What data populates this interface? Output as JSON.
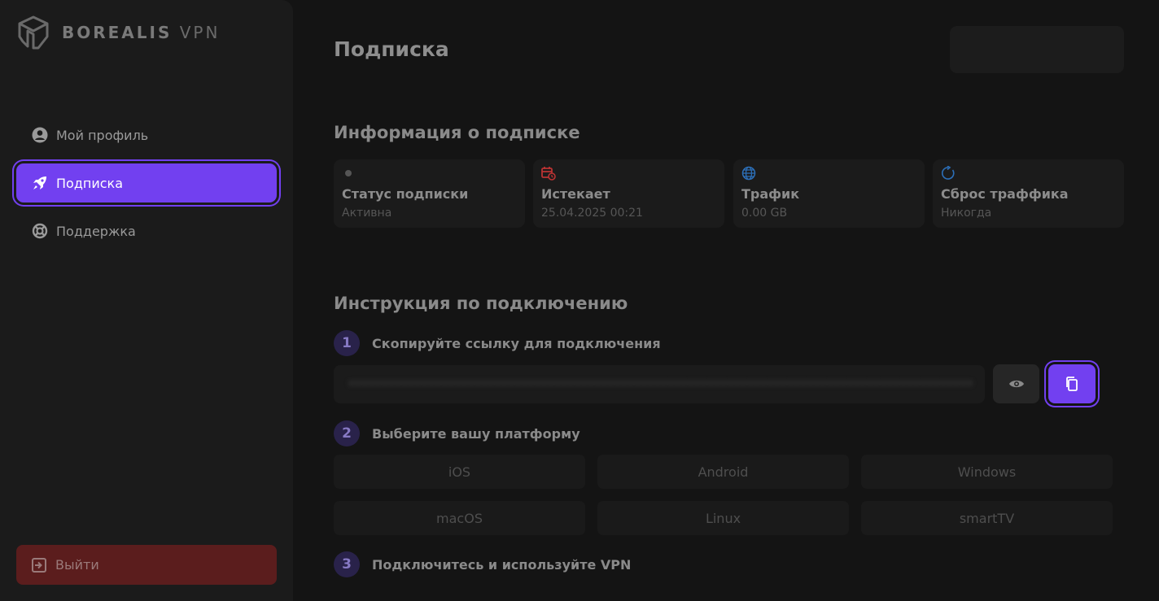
{
  "brand": {
    "name_bold": "BOREALIS",
    "name_light": "VPN",
    "logo_icon": "borealis-logo-icon"
  },
  "sidebar": {
    "items": [
      {
        "label": "Мой профиль",
        "icon": "user-circle-icon",
        "active": false
      },
      {
        "label": "Подписка",
        "icon": "rocket-icon",
        "active": true
      },
      {
        "label": "Поддержка",
        "icon": "lifebuoy-icon",
        "active": false
      }
    ],
    "logout_label": "Выйти",
    "logout_icon": "logout-icon"
  },
  "header": {
    "title": "Подписка"
  },
  "subscription": {
    "section_title": "Информация о подписке",
    "cards": [
      {
        "label": "Статус подписки",
        "value": "Активна",
        "icon": "status-dot-icon"
      },
      {
        "label": "Истекает",
        "value": "25.04.2025 00:21",
        "icon": "calendar-clock-icon"
      },
      {
        "label": "Трафик",
        "value": "0.00 GB",
        "icon": "globe-icon"
      },
      {
        "label": "Сброс траффика",
        "value": "Никогда",
        "icon": "refresh-icon"
      }
    ]
  },
  "instructions": {
    "section_title": "Инструкция по подключению",
    "steps": [
      {
        "num": "1",
        "text": "Скопируйте ссылку для подключения"
      },
      {
        "num": "2",
        "text": "Выберите вашу платформу"
      },
      {
        "num": "3",
        "text": "Подключитесь и используйте VPN"
      }
    ],
    "platforms": [
      "iOS",
      "Android",
      "Windows",
      "macOS",
      "Linux",
      "smartTV"
    ]
  },
  "colors": {
    "accent": "#7240f0",
    "logout_bg": "#5b1d1d",
    "background": "#141414",
    "sidebar": "#1b1b1b"
  }
}
